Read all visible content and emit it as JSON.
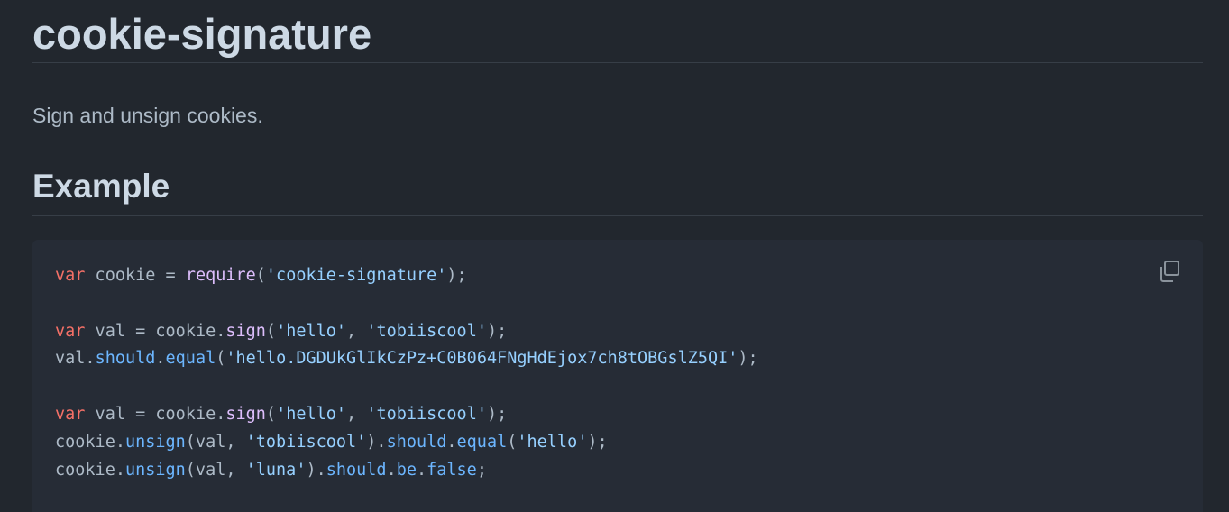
{
  "title": "cookie-signature",
  "description": "Sign and unsign cookies.",
  "example_heading": "Example",
  "copy_icon": "copy-icon",
  "code": {
    "l1": {
      "kw": "var",
      "t1": " cookie = ",
      "fn": "require",
      "t2": "(",
      "str": "'cookie-signature'",
      "t3": ");"
    },
    "l3": {
      "kw": "var",
      "t1": " val = cookie.",
      "fn": "sign",
      "t2": "(",
      "s1": "'hello'",
      "t3": ", ",
      "s2": "'tobiiscool'",
      "t4": ");"
    },
    "l4": {
      "t1": "val.",
      "p1": "should",
      "t2": ".",
      "p2": "equal",
      "t3": "(",
      "s1": "'hello.DGDUkGlIkCzPz+C0B064FNgHdEjox7ch8tOBGslZ5QI'",
      "t4": ");"
    },
    "l6": {
      "kw": "var",
      "t1": " val = cookie.",
      "fn": "sign",
      "t2": "(",
      "s1": "'hello'",
      "t3": ", ",
      "s2": "'tobiiscool'",
      "t4": ");"
    },
    "l7": {
      "t1": "cookie.",
      "fn": "unsign",
      "t2": "(val, ",
      "s1": "'tobiiscool'",
      "t3": ").",
      "p1": "should",
      "t4": ".",
      "p2": "equal",
      "t5": "(",
      "s2": "'hello'",
      "t6": ");"
    },
    "l8": {
      "t1": "cookie.",
      "fn": "unsign",
      "t2": "(val, ",
      "s1": "'luna'",
      "t3": ").",
      "p1": "should",
      "t4": ".",
      "p2": "be",
      "t5": ".",
      "p3": "false",
      "t6": ";"
    }
  }
}
